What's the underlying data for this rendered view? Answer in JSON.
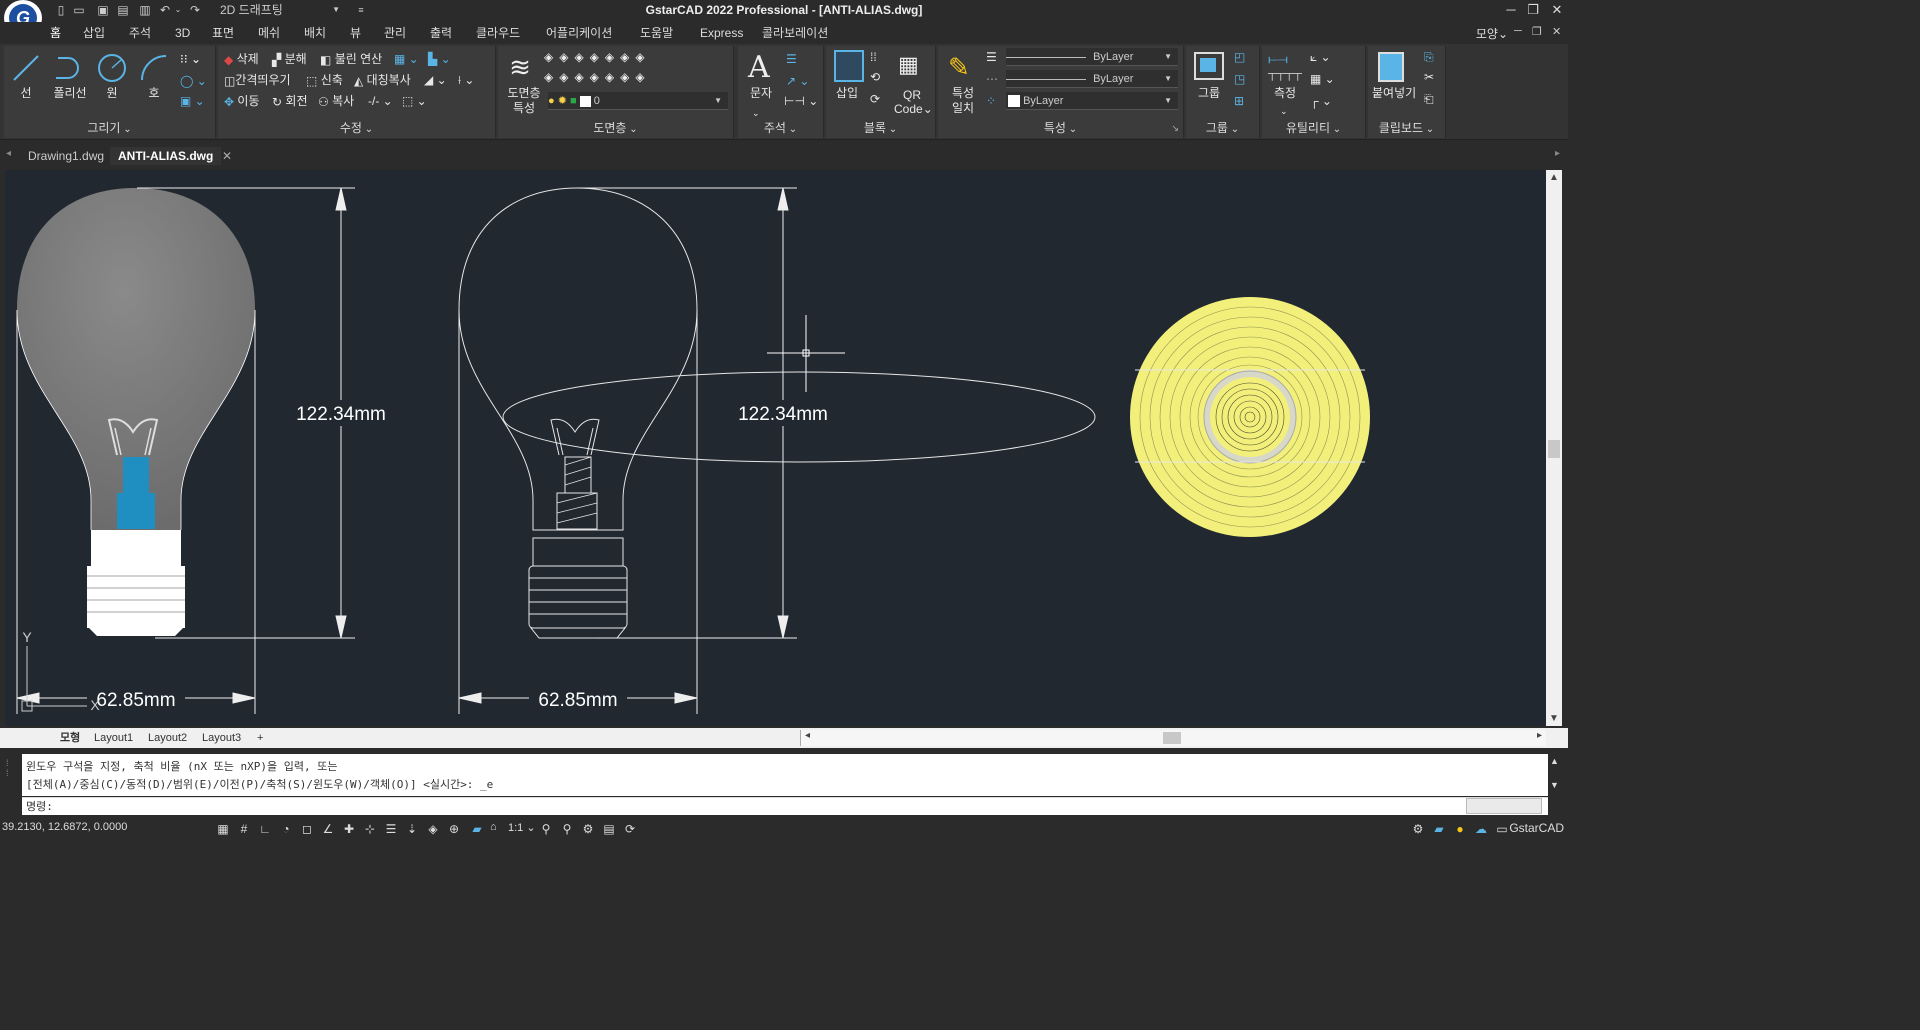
{
  "titlebar": {
    "workspace": "2D 드래프팅",
    "title": "GstarCAD 2022 Professional - [ANTI-ALIAS.dwg]",
    "logo_letter": "G",
    "icons": [
      "new-file-icon",
      "open-folder-icon",
      "save-icon",
      "save-as-icon",
      "print-icon",
      "undo-icon",
      "redo-icon"
    ]
  },
  "menu": {
    "tabs": [
      "홈",
      "삽입",
      "주석",
      "3D",
      "표면",
      "메쉬",
      "배치",
      "뷰",
      "관리",
      "출력",
      "클라우드",
      "어플리케이션",
      "도움말",
      "Express",
      "콜라보레이션"
    ],
    "active": "홈",
    "right_label": "모양"
  },
  "ribbon": {
    "draw": {
      "title": "그리기",
      "line": "선",
      "polyline": "폴리선",
      "circle": "원",
      "arc": "호"
    },
    "modify": {
      "title": "수정",
      "erase": "삭제",
      "explode": "분해",
      "boolean": "불린 연산",
      "offset": "간격띄우기",
      "stretch": "신축",
      "mirror": "대칭복사",
      "move": "이동",
      "rotate": "회전",
      "copy": "복사"
    },
    "layer": {
      "title": "도면층",
      "props_line1": "도면층",
      "props_line2": "특성",
      "current_layer": "0"
    },
    "annotation": {
      "title": "주석",
      "text": "문자"
    },
    "block": {
      "title": "블록",
      "insert": "삽입",
      "qr_line1": "QR",
      "qr_line2": "Code"
    },
    "properties": {
      "title": "특성",
      "match_line1": "특성",
      "match_line2": "일치",
      "bylayer1": "ByLayer",
      "bylayer2": "ByLayer",
      "bylayer3": "ByLayer"
    },
    "group": {
      "title": "그룹",
      "group": "그룹"
    },
    "utility": {
      "title": "유틸리티",
      "measure": "측정"
    },
    "clipboard": {
      "title": "클립보드",
      "paste": "붙여넣기"
    }
  },
  "doc_tabs": [
    "Drawing1.dwg",
    "ANTI-ALIAS.dwg"
  ],
  "drawing": {
    "dim_height_left": "122.34mm",
    "dim_height_right": "122.34mm",
    "dim_width_left": "62.85mm",
    "dim_width_right": "62.85mm",
    "ucs_y": "Y",
    "ucs_x": "X",
    "colors": {
      "bg": "#212830",
      "bulb_fill": "#7a7a7a",
      "cyan": "#1e8fc0",
      "yellow": "#f2f07a"
    }
  },
  "layout_tabs": [
    "모형",
    "Layout1",
    "Layout2",
    "Layout3",
    "+"
  ],
  "command": {
    "line1": "윈도우 구석을 지정, 축척 비율 (nX 또는 nXP)을 입력, 또는",
    "line2": "[전체(A)/중심(C)/동적(D)/범위(E)/이전(P)/축척(S)/윈도우(W)/객체(O)] <실시간>: _e",
    "prompt": "명령:"
  },
  "status": {
    "coords": "39.2130, 12.6872, 0.0000",
    "scale": "1:1",
    "brand": "GstarCAD"
  }
}
